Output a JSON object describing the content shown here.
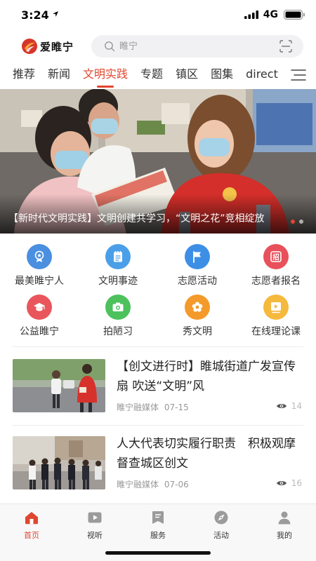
{
  "status_bar": {
    "time": "3:24",
    "network": "4G"
  },
  "header": {
    "logo_text": "爱睢宁",
    "search_placeholder": "睢宁"
  },
  "tabs": [
    {
      "label": "推荐",
      "active": false
    },
    {
      "label": "新闻",
      "active": false
    },
    {
      "label": "文明实践",
      "active": true
    },
    {
      "label": "专题",
      "active": false
    },
    {
      "label": "镇区",
      "active": false
    },
    {
      "label": "图集",
      "active": false
    },
    {
      "label": "direct",
      "active": false
    }
  ],
  "banner": {
    "caption": "【新时代文明实践】文明创建共学习，“文明之花”竞相绽放",
    "slide_count": 2,
    "active_slide": 1
  },
  "quick_links": [
    {
      "label": "最美睢宁人",
      "icon": "medal-icon",
      "color": "#4a8fe0"
    },
    {
      "label": "文明事迹",
      "icon": "notepad-icon",
      "color": "#4a9fe8"
    },
    {
      "label": "志愿活动",
      "icon": "flag-icon",
      "color": "#3d8fe6"
    },
    {
      "label": "志愿者报名",
      "icon": "recruit-icon",
      "color": "#e8505b"
    },
    {
      "label": "公益睢宁",
      "icon": "graduation-cap-icon",
      "color": "#e8565c"
    },
    {
      "label": "拍陋习",
      "icon": "camera-icon",
      "color": "#4cc15c"
    },
    {
      "label": "秀文明",
      "icon": "flower-icon",
      "color": "#f39a2a"
    },
    {
      "label": "在线理论课",
      "icon": "video-lesson-icon",
      "color": "#f5b93e"
    }
  ],
  "news": [
    {
      "title": "【创文进行时】睢城街道广发宣传扇 吹送“文明”风",
      "source": "睢宁融媒体",
      "date": "07-15",
      "views": "14"
    },
    {
      "title": "人大代表切实履行职责　积极观摩督查城区创文",
      "source": "睢宁融媒体",
      "date": "07-06",
      "views": "16"
    }
  ],
  "bottom_nav": [
    {
      "label": "首页",
      "icon": "home-icon",
      "active": true
    },
    {
      "label": "视听",
      "icon": "play-icon",
      "active": false
    },
    {
      "label": "服务",
      "icon": "bookmark-icon",
      "active": false
    },
    {
      "label": "活动",
      "icon": "compass-icon",
      "active": false
    },
    {
      "label": "我的",
      "icon": "user-icon",
      "active": false
    }
  ],
  "colors": {
    "accent": "#e0462f",
    "inactive_icon": "#9b9b9b"
  }
}
